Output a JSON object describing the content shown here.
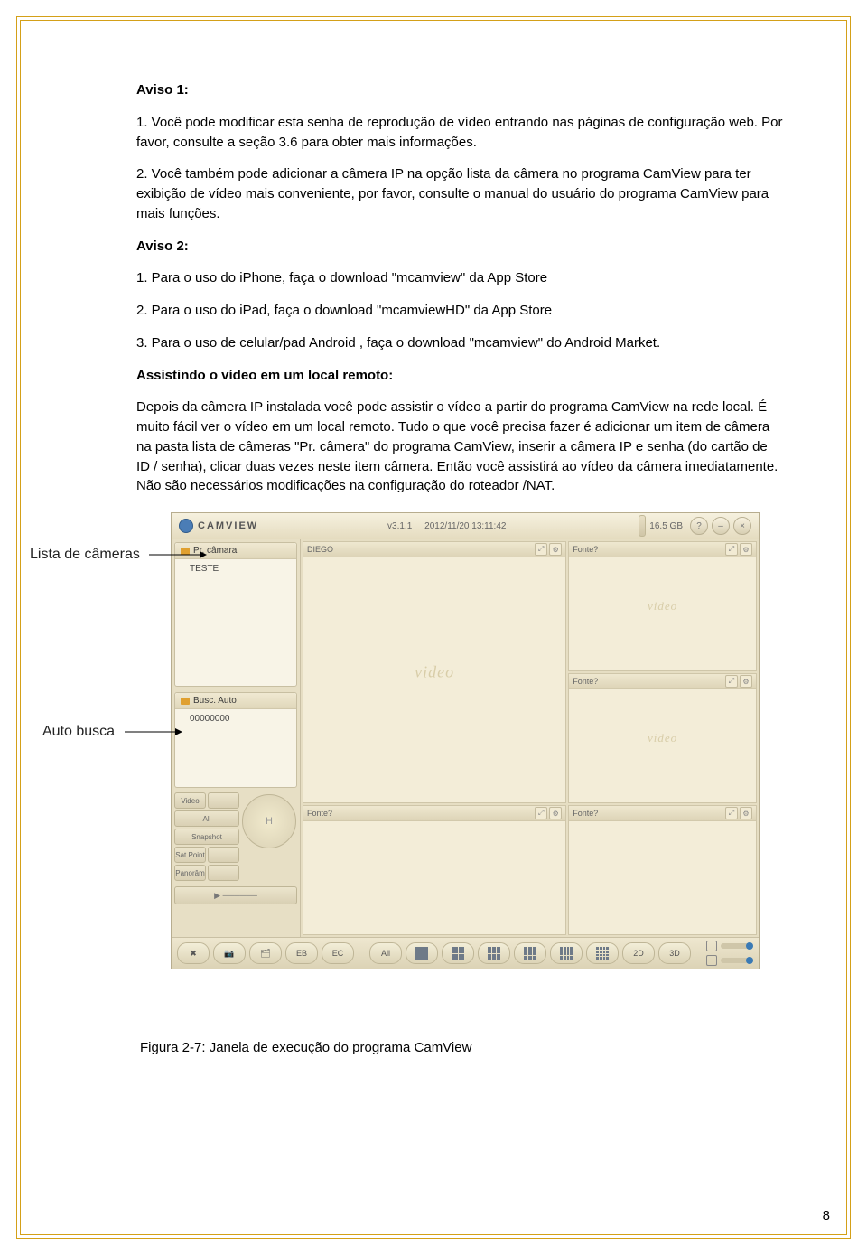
{
  "doc": {
    "aviso1_heading": "Aviso 1:",
    "aviso1_item1": "1. Você pode modificar esta senha de reprodução de vídeo entrando nas páginas de configuração web. Por favor, consulte a seção 3.6 para obter mais informações.",
    "aviso1_item2": "2. Você também pode adicionar a câmera IP na opção lista da câmera no programa CamView para ter exibição de vídeo mais conveniente, por favor, consulte o manual do usuário do programa CamView para mais funções.",
    "aviso2_heading": "Aviso 2:",
    "aviso2_item1": "1. Para o uso do iPhone, faça o download \"mcamview\" da App Store",
    "aviso2_item2": "2. Para o uso do iPad, faça o download \"mcamviewHD\" da App Store",
    "aviso2_item3": "3. Para o uso de celular/pad Android , faça o download \"mcamview\" do Android Market.",
    "remote_heading": "Assistindo o vídeo em um local remoto:",
    "remote_body": "Depois da câmera IP instalada você pode assistir o vídeo a partir do programa CamView na rede local. É muito fácil ver o vídeo em um local remoto. Tudo o que você precisa fazer é adicionar um item de câmera na pasta lista de câmeras \"Pr. câmera\"  do programa CamView, inserir a câmera IP e senha (do cartão de ID / senha), clicar duas vezes neste item câmera. Então você assistirá ao vídeo da câmera imediatamente. Não são necessários modificações na configuração do roteador /NAT.",
    "annot_cameras": "Lista de câmeras",
    "annot_search": "Auto busca",
    "figure_caption": "Figura 2-7: Janela de execução do programa CamView",
    "page_number": "8"
  },
  "app": {
    "brand": "CAMVIEW",
    "version": "v3.1.1",
    "datetime": "2012/11/20 13:11:42",
    "storage": "16.5 GB",
    "sidebar": {
      "cameras_header": "Pr. câmara",
      "camera_item": "TESTE",
      "search_header": "Busc. Auto",
      "search_item": "00000000",
      "btn_video": "Video",
      "btn_all": "All",
      "btn_snapshot": "Snapshot",
      "btn_sat": "Sat Point",
      "btn_pan": "Panorâm"
    },
    "tiles": {
      "big_title": "DIEGO",
      "t2_title": "Fonte?",
      "t3_title": "Fonte?",
      "t4_title": "Fonte?",
      "t5_title": "Fonte?",
      "watermark": "video"
    },
    "footer": {
      "all": "All",
      "btn_2d": "2D",
      "btn_3d": "3D",
      "eb": "EB",
      "ec": "EC"
    }
  }
}
